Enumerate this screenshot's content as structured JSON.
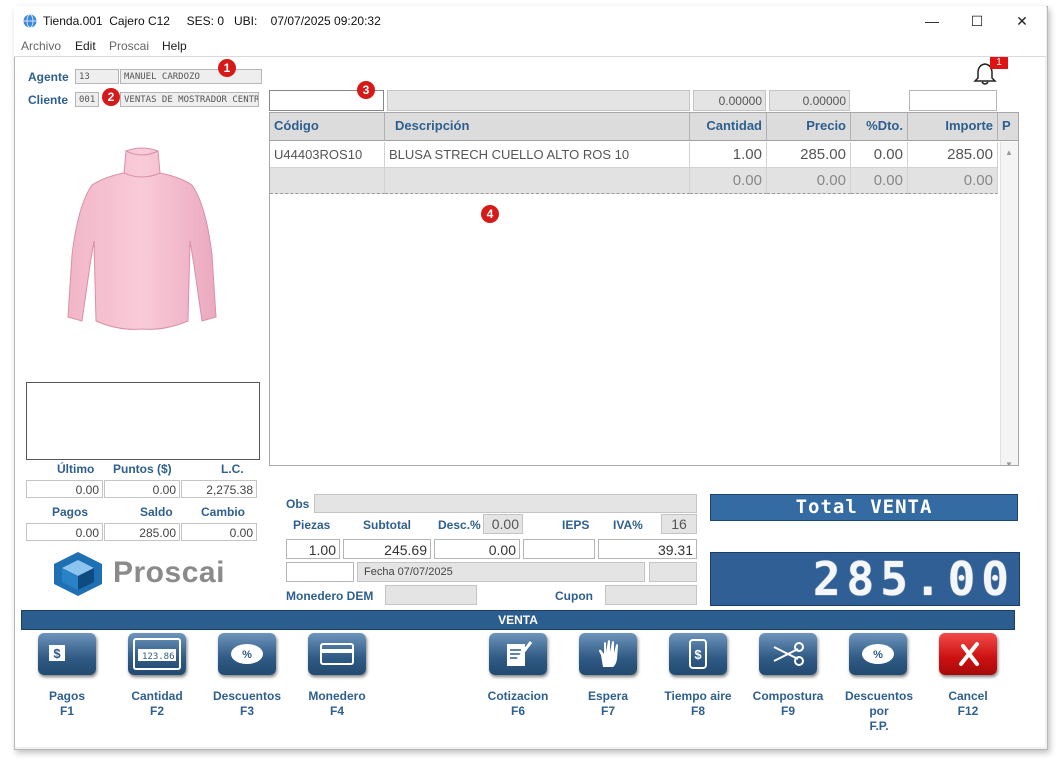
{
  "window": {
    "title": "Tienda.001  Cajero C12     SES: 0   UBI:    07/07/2025 09:20:32",
    "minimize": "—",
    "maximize": "☐",
    "close": "✕"
  },
  "menu": [
    "Archivo",
    "Edit",
    "Proscai",
    "Help"
  ],
  "agent": {
    "label": "Agente",
    "code": "13",
    "name": "MANUEL CARDOZO"
  },
  "client": {
    "label": "Cliente",
    "code": "001",
    "name": "VENTAS DE MOSTRADOR CENTRO"
  },
  "badges": [
    "1",
    "2",
    "3",
    "4"
  ],
  "notification_count": "1",
  "entry": {
    "code": "",
    "description": "",
    "value1": "0.00000",
    "value2": "0.00000",
    "extra": ""
  },
  "grid": {
    "headers": [
      "Código",
      "Descripción",
      "Cantidad",
      "Precio",
      "%Dto.",
      "Importe",
      "P"
    ],
    "rows": [
      [
        "U44403ROS10",
        "BLUSA STRECH CUELLO ALTO ROS 10",
        "1.00",
        "285.00",
        "0.00",
        "285.00"
      ],
      [
        "",
        "",
        "0.00",
        "0.00",
        "0.00",
        "0.00"
      ]
    ]
  },
  "customer_stats": {
    "labels1": [
      "Último",
      "Puntos ($)",
      "L.C."
    ],
    "values1": [
      "0.00",
      "0.00",
      "2,275.38"
    ],
    "labels2": [
      "Pagos",
      "Saldo",
      "Cambio"
    ],
    "values2": [
      "0.00",
      "285.00",
      "0.00"
    ]
  },
  "logo_text": "Proscai",
  "totals": {
    "obs_label": "Obs",
    "piezas_label": "Piezas",
    "subtotal_label": "Subtotal",
    "desc_label": "Desc.%",
    "desc_pct": "0.00",
    "ieps_label": "IEPS",
    "iva_label": "IVA%",
    "iva_pct": "16",
    "piezas": "1.00",
    "subtotal": "245.69",
    "descuento": "0.00",
    "ieps": "",
    "iva": "39.31",
    "fecha": "Fecha 07/07/2025",
    "monedero_label": "Monedero DEM",
    "cupon_label": "Cupon"
  },
  "total": {
    "label": "Total VENTA",
    "amount": "285.00"
  },
  "mode": "VENTA",
  "colors": {
    "accent": "#2c5d8f",
    "label": "#2e5f8e",
    "badge": "#d61a1a",
    "cancel": "#cc1010"
  },
  "actions": [
    {
      "label": "Pagos",
      "key": "F1",
      "icon": "dollar-icon"
    },
    {
      "label": "Cantidad",
      "key": "F2",
      "icon": "calculator-icon"
    },
    {
      "label": "Descuentos",
      "key": "F3",
      "icon": "percent-icon"
    },
    {
      "label": "Monedero",
      "key": "F4",
      "icon": "card-icon"
    },
    {
      "label": "Cotizacion",
      "key": "F6",
      "icon": "quote-edit-icon"
    },
    {
      "label": "Espera",
      "key": "F7",
      "icon": "hand-icon"
    },
    {
      "label": "Tiempo aire",
      "key": "F8",
      "icon": "phone-dollar-icon"
    },
    {
      "label": "Compostura",
      "key": "F9",
      "icon": "scissors-icon"
    },
    {
      "label": "Descuentos por",
      "label2": "F.P.",
      "icon": "percent-icon"
    },
    {
      "label": "Cancel",
      "key": "F12",
      "icon": "cancel-x-icon"
    }
  ],
  "calc_text": "123.86"
}
